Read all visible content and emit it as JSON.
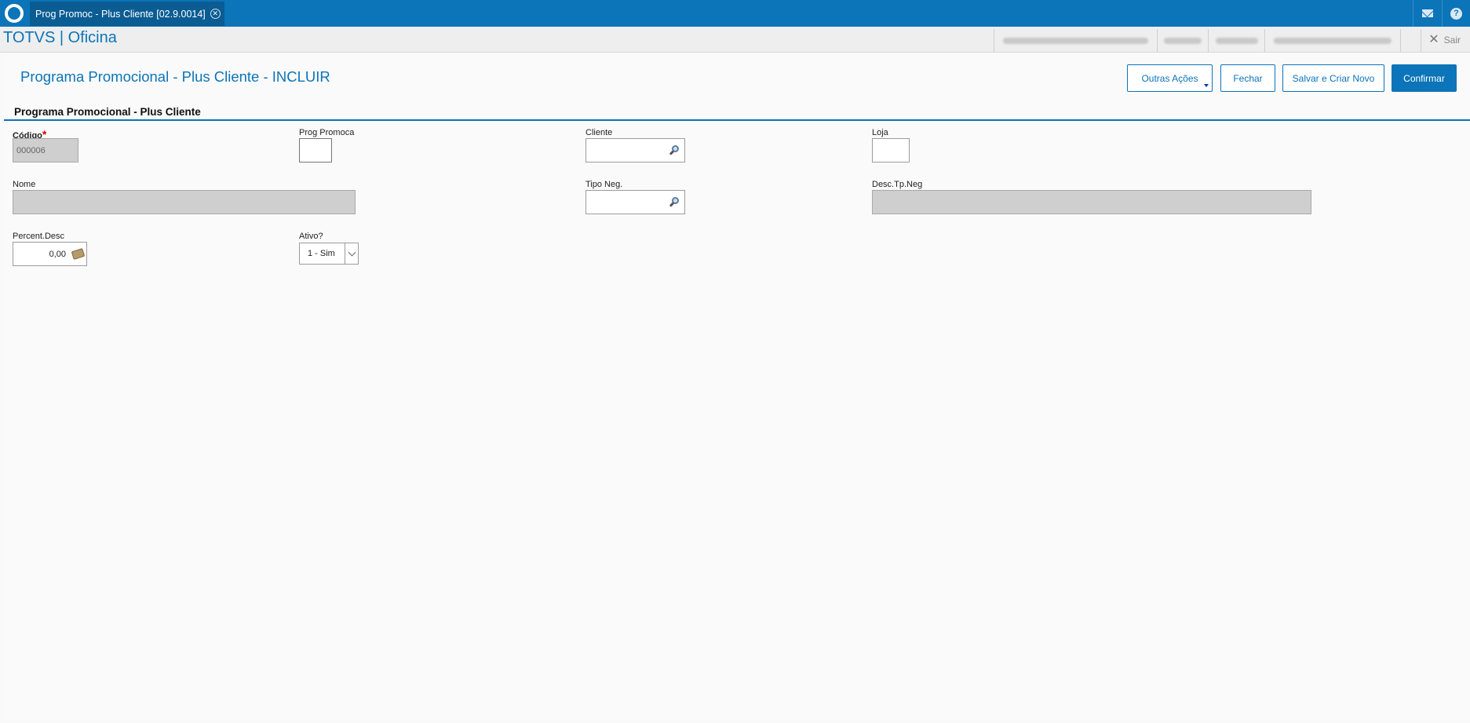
{
  "tab": {
    "title": "Prog Promoc - Plus Cliente [02.9.0014]",
    "close": "✕"
  },
  "header": {
    "brand": "TOTVS | Oficina",
    "logout": "Sair"
  },
  "page": {
    "title": "Programa Promocional - Plus Cliente - INCLUIR"
  },
  "actions": {
    "more": "Outras Ações",
    "close": "Fechar",
    "save_new": "Salvar e Criar Novo",
    "confirm": "Confirmar"
  },
  "form": {
    "section": "Programa Promocional - Plus Cliente",
    "codigo": {
      "label": "Código",
      "required_mark": "*",
      "value": "000006"
    },
    "prog_promoca": {
      "label": "Prog Promoca",
      "value": ""
    },
    "cliente": {
      "label": "Cliente",
      "value": ""
    },
    "loja": {
      "label": "Loja",
      "value": ""
    },
    "nome": {
      "label": "Nome",
      "value": ""
    },
    "tipo_neg": {
      "label": "Tipo Neg.",
      "value": ""
    },
    "desc_tp_neg": {
      "label": "Desc.Tp.Neg",
      "value": ""
    },
    "percent_desc": {
      "label": "Percent.Desc",
      "value": "0,00"
    },
    "ativo": {
      "label": "Ativo?",
      "value": "1 - Sim"
    }
  },
  "colors": {
    "accent": "#0c74b8",
    "required": "#dd0000"
  },
  "icons": [
    "totvs-logo-icon",
    "close-tab-icon",
    "mail-icon",
    "help-icon",
    "close-icon",
    "search-icon",
    "calculator-icon",
    "chevron-down-icon"
  ]
}
